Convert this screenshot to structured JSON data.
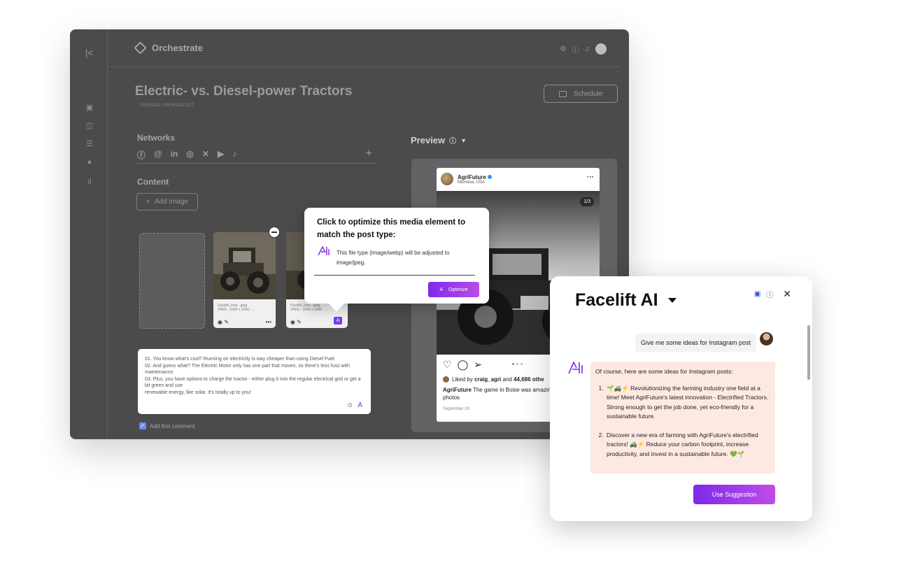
{
  "app": {
    "brand": "Orchestrate",
    "page_title": "Electric- vs. Diesel-power Tractors",
    "date_range": "01/09/2024 | 08/09/2024  CET",
    "schedule_label": "Schedule",
    "networks_label": "Networks",
    "networks": [
      "facebook-icon",
      "threads-icon",
      "linkedin-icon",
      "instagram-icon",
      "x-icon",
      "youtube-icon",
      "tiktok-icon"
    ],
    "content_label": "Content",
    "add_image_label": "Add Image",
    "media": [
      {
        "name": "Facelift_nner...jpeg",
        "meta": "JPEG - 1066 x 1066 - ..."
      },
      {
        "name": "Facelift_nner...jpeg",
        "meta": "JPEG - 1066 x 1066 - ..."
      }
    ],
    "post_text": [
      "01. You know what's cool? Running on electricity is way cheaper than using Diesel Fuel.",
      "02. And guess what? The Electric Motor only has one part that moves, so there's less fuss with maintenance.",
      "03. Plus, you have options to charge the tractor - either plug it into the regular electrical grid or get a bit green and use",
      "renewable energy, like solar. It's totally up to you!"
    ],
    "first_comment_label": "Add first comment",
    "preview_label": "Preview"
  },
  "instagram_preview": {
    "username": "AgriFuture",
    "location": "Montana, USA",
    "image_counter": "1/3",
    "liked_by_prefix": "Liked by ",
    "liked_by_user": "craig_agri",
    "liked_by_and": " and ",
    "liked_by_count": "44,686 othe",
    "caption_user": "AgriFuture",
    "caption_text": " The game in Boise was amazing! share some photos",
    "date": "September 19"
  },
  "tooltip": {
    "title": "Click to optimize this media element to match the post type:",
    "body": "This file type (image/webp) will be adjusted to image/jpeg.",
    "button_label": "Optimize"
  },
  "ai_panel": {
    "title": "Facelift AI",
    "user_prompt": "Give me some ideas for Instagram post",
    "reply_intro": "Of course, here are some ideas for Instagram posts:",
    "reply_items": [
      "🌱🚜⚡ Revolutionizing the farming industry one field at a time! Meet AgriFuture's latest innovation - Electrified Tractors. Strong enough to get the job done, yet eco-friendly for a sustainable future.",
      "Discover a new era of farming with AgriFuture's electrified tractors! 🚜⚡ Reduce your carbon footprint, increase productivity, and invest in a sustainable future. 💚🌱"
    ],
    "use_suggestion_label": "Use Suggestion"
  },
  "colors": {
    "app_bg": "#4b4b4b",
    "accent_purple": "#7d2ae8",
    "ai_reply_bg": "#fde9e2",
    "instagram_blue": "#3897f0"
  }
}
